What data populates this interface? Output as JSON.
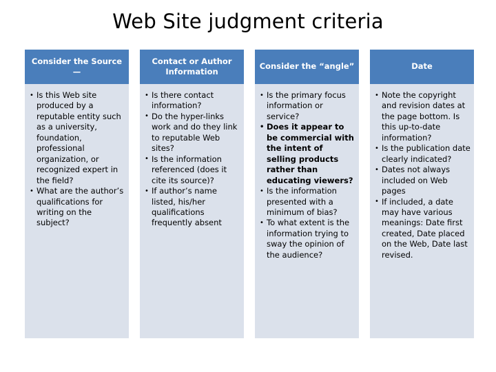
{
  "title": "Web Site judgment criteria",
  "colors": {
    "header_bg": "#4a7ebb",
    "header_text": "#ffffff",
    "body_bg": "#dbe1eb",
    "body_text": "#000000",
    "slide_bg": "#ffffff"
  },
  "columns": [
    {
      "header": "Consider the Source—",
      "bullets": [
        {
          "text": "Is this Web site produced by a reputable entity such as a university, foundation, professional organization, or recognized expert in the field?",
          "bold": false
        },
        {
          "text": "What are the author’s qualifications for writing on the subject?",
          "bold": false
        }
      ]
    },
    {
      "header": "Contact or Author Information",
      "bullets": [
        {
          "text": "Is there contact information?",
          "bold": false
        },
        {
          "text": "Do the hyper-links work and do they link to reputable Web sites?",
          "bold": false
        },
        {
          "text": "Is the information referenced (does it cite its source)?",
          "bold": false
        },
        {
          "text": "If author’s name listed, his/her qualifications frequently absent",
          "bold": false
        }
      ]
    },
    {
      "header": "Consider the “angle”",
      "bullets": [
        {
          "text": "Is the primary focus information or service?",
          "bold": false
        },
        {
          "text": "Does it appear to be commercial with the intent of selling products rather than educating viewers?",
          "bold": true
        },
        {
          "text": "Is the information presented with a minimum of bias?",
          "bold": false
        },
        {
          "text": "To what extent is the information trying to sway the opinion of the audience?",
          "bold": false
        }
      ]
    },
    {
      "header": "Date",
      "bullets": [
        {
          "text": "Note the copyright and revision dates at the page bottom. Is this up-to-date information?",
          "bold": false
        },
        {
          "text": "Is the publication date clearly indicated?",
          "bold": false
        },
        {
          "text": "Dates not always included on Web pages",
          "bold": false
        },
        {
          "text": "If included, a date may have various meanings: Date first created, Date placed on the Web, Date last revised.",
          "bold": false
        }
      ]
    }
  ]
}
